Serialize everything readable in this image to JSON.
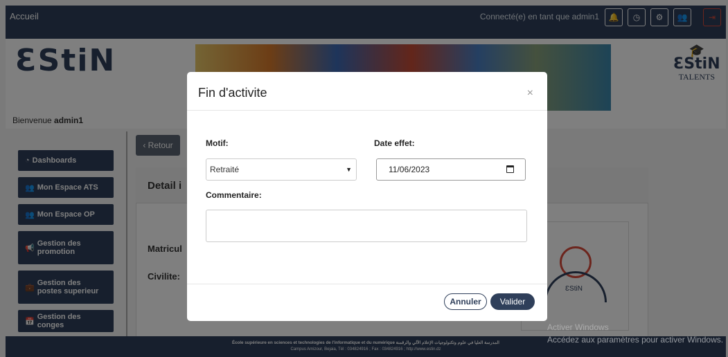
{
  "topbar": {
    "brand": "Accueil",
    "connected_text": "Connecté(e) en tant que admin1",
    "icons": [
      {
        "name": "bell-icon",
        "glyph": "🔔"
      },
      {
        "name": "clock-icon",
        "glyph": "◷"
      },
      {
        "name": "gear-icon",
        "glyph": "⚙"
      },
      {
        "name": "users-icon",
        "glyph": "👥"
      },
      {
        "name": "logout-icon",
        "glyph": "⇥"
      }
    ],
    "colors": {
      "bar": "#2f3f5a",
      "logout_border": "#d94a3a"
    }
  },
  "header": {
    "logo_text": "ƐStiN",
    "talents_logo_line1": "ƐStiN",
    "talents_logo_line2": "TALENTS",
    "welcome_prefix": "Bienvenue ",
    "welcome_user": "admin1"
  },
  "sidebar": {
    "items": [
      {
        "icon": "◔",
        "label": "Dashboards"
      },
      {
        "icon": "👥",
        "label": "Mon Espace ATS"
      },
      {
        "icon": "👥",
        "label": "Mon Espace OP"
      },
      {
        "icon": "📢",
        "label": "Gestion des promotion"
      },
      {
        "icon": "💼",
        "label": "Gestion des postes superieur"
      },
      {
        "icon": "📅",
        "label": "Gestion des conges"
      }
    ]
  },
  "content": {
    "back_button": "Retour",
    "detail_title": "Detail i",
    "matricule_label": "Matricul",
    "civilite_label": "Civilite:",
    "avatar_text": "ƐStiN"
  },
  "footer": {
    "line1": "École supérieure en sciences et technologies de l'informatique et du numérique المدرسة العليا في علوم وتكنولوجيات الإعلام الآلي والرقمنة",
    "line2": "Campus Amizour, Bejaia, Tél : 034824916 ; Fax : 034824916 ; http://www.estin.dz"
  },
  "modal": {
    "title": "Fin d'activite",
    "close_glyph": "×",
    "motif_label": "Motif:",
    "motif_value": "Retraité",
    "date_label": "Date effet:",
    "date_value": "11/06/2023",
    "commentaire_label": "Commentaire:",
    "commentaire_value": "",
    "cancel_label": "Annuler",
    "confirm_label": "Valider"
  },
  "watermark": {
    "line1": "Activer Windows",
    "line2": "Accédez aux paramètres pour activer Windows."
  }
}
